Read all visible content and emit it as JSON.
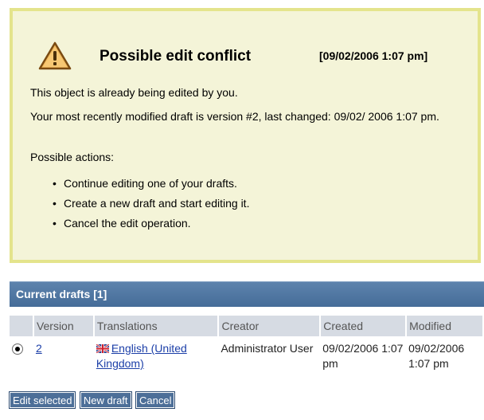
{
  "conflict": {
    "title": "Possible edit conflict",
    "timestamp": "[09/02/2006 1:07 pm]",
    "message1": "This object is already being edited by you.",
    "message2": "Your most recently modified draft is version #2, last changed: 09/02/ 2006 1:07 pm.",
    "actions_label": "Possible actions:",
    "actions": [
      "Continue editing one of your drafts.",
      "Create a new draft and start editing it.",
      "Cancel the edit operation."
    ],
    "colors": {
      "box_bg": "#f4f4d8",
      "box_border": "#e4e48c",
      "icon": "warning-triangle-icon"
    }
  },
  "drafts": {
    "header": "Current drafts [1]",
    "columns": [
      "Version",
      "Translations",
      "Creator",
      "Created",
      "Modified"
    ],
    "rows": [
      {
        "selected": true,
        "version": "2",
        "translation": "English (United Kingdom)",
        "creator": "Administrator User",
        "created": "09/02/2006 1:07 pm",
        "modified": "09/02/2006 1:07 pm"
      }
    ]
  },
  "buttons": {
    "edit_selected": "Edit selected",
    "new_draft": "New draft",
    "cancel": "Cancel"
  }
}
